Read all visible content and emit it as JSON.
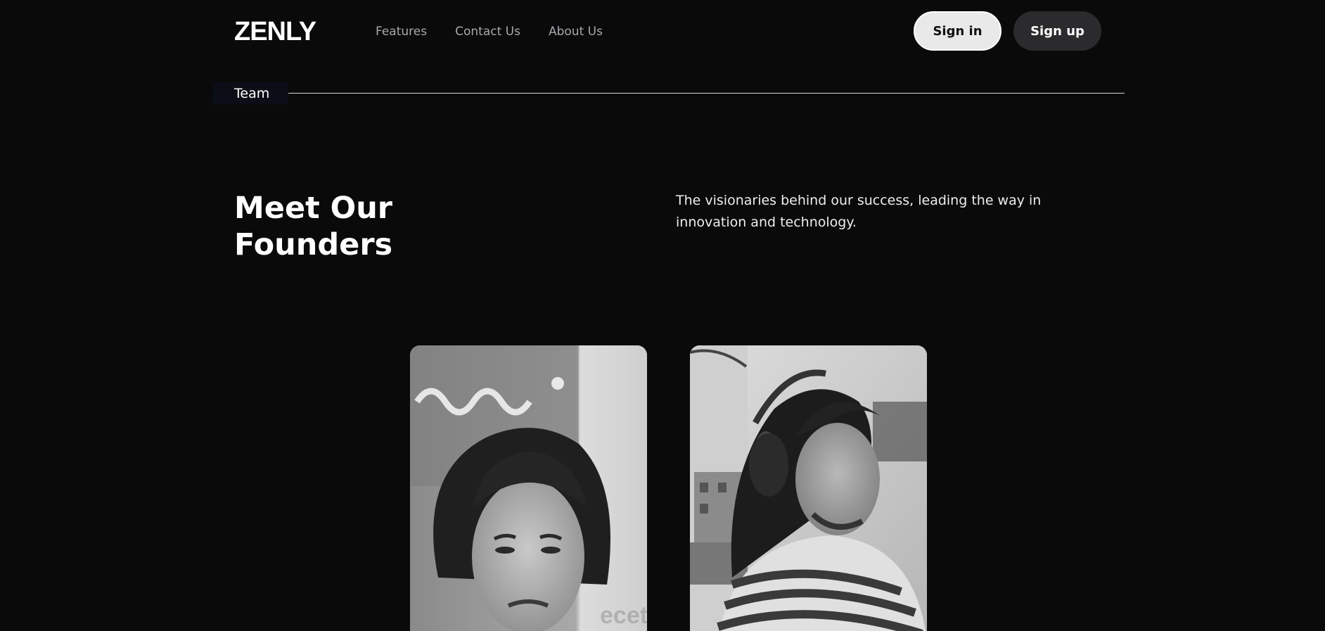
{
  "header": {
    "logo": "ZENLY",
    "nav": [
      "Features",
      "Contact Us",
      "About Us"
    ],
    "sign_in": "Sign in",
    "sign_up": "Sign up"
  },
  "section": {
    "tag": "Team",
    "title_line1": "Meet Our",
    "title_line2": "Founders",
    "description": "The visionaries behind our success, leading the way in innovation and technology."
  },
  "founders": [
    {
      "photo": "founder-portrait-photo-1"
    },
    {
      "photo": "founder-portrait-photo-2"
    }
  ],
  "colors": {
    "background": "#0a0a0b",
    "sign_in_bg": "#e9e9ea",
    "sign_up_bg": "#2b2b2d",
    "nav_text": "#a8a8ad"
  }
}
